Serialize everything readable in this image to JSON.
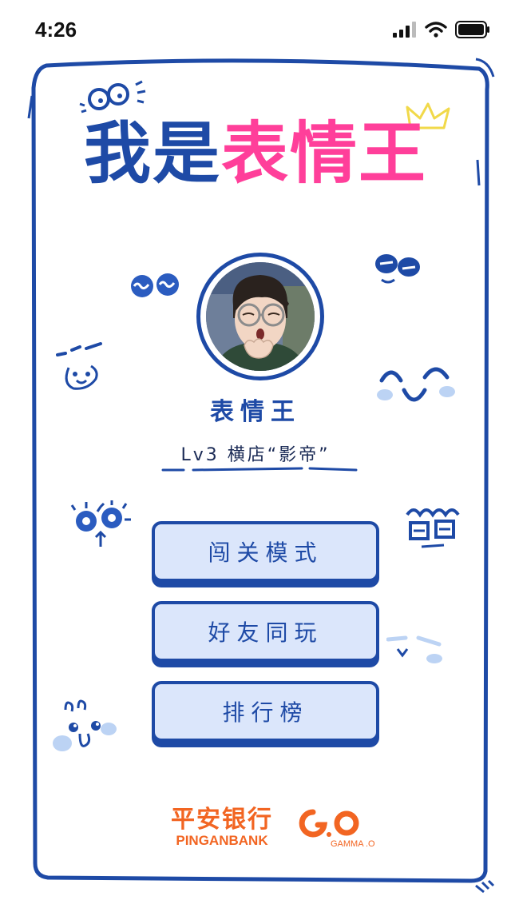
{
  "status_bar": {
    "time": "4:26"
  },
  "title": {
    "part_a": "我是",
    "part_b": "表情王"
  },
  "player": {
    "name": "表情王",
    "level": "Lv3 横店“影帝”"
  },
  "menu": [
    {
      "label": "闯关模式"
    },
    {
      "label": "好友同玩"
    },
    {
      "label": "排行榜"
    }
  ],
  "footer": {
    "bank_cn": "平安银行",
    "bank_en": "PINGANBANK",
    "gamma_text": "GAMMA .O"
  },
  "colors": {
    "blue": "#1e4aa6",
    "pink": "#ff3f9a",
    "button_fill": "#dbe6fb",
    "brand_orange": "#f26522"
  }
}
